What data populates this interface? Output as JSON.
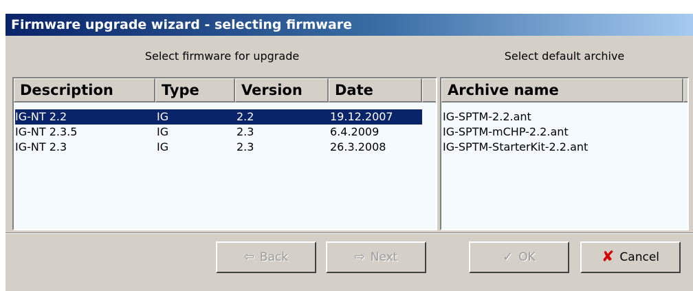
{
  "window": {
    "title": "Firmware upgrade wizard - selecting firmware"
  },
  "firmware": {
    "label": "Select firmware for upgrade",
    "columns": [
      "Description",
      "Type",
      "Version",
      "Date"
    ],
    "rows": [
      {
        "description": "IG-NT 2.2",
        "type": "IG",
        "version": "2.2",
        "date": "19.12.2007",
        "selected": true
      },
      {
        "description": "IG-NT 2.3.5",
        "type": "IG",
        "version": "2.3",
        "date": "6.4.2009",
        "selected": false
      },
      {
        "description": "IG-NT 2.3",
        "type": "IG",
        "version": "2.3",
        "date": "26.3.2008",
        "selected": false
      }
    ]
  },
  "archive": {
    "label": "Select default archive",
    "column": "Archive name",
    "items": [
      "IG-SPTM-2.2.ant",
      "IG-SPTM-mCHP-2.2.ant",
      "IG-SPTM-StarterKit-2.2.ant"
    ]
  },
  "buttons": {
    "back": {
      "label": "Back",
      "icon": "left-arrow-icon",
      "enabled": false
    },
    "next": {
      "label": "Next",
      "icon": "right-arrow-icon",
      "enabled": false
    },
    "ok": {
      "label": "OK",
      "icon": "checkmark-icon",
      "enabled": false
    },
    "cancel": {
      "label": "Cancel",
      "icon": "red-x-icon",
      "enabled": true
    }
  },
  "colors": {
    "selection": "#0a246a",
    "cancel_icon": "#d40000",
    "face": "#d4d0c8"
  }
}
